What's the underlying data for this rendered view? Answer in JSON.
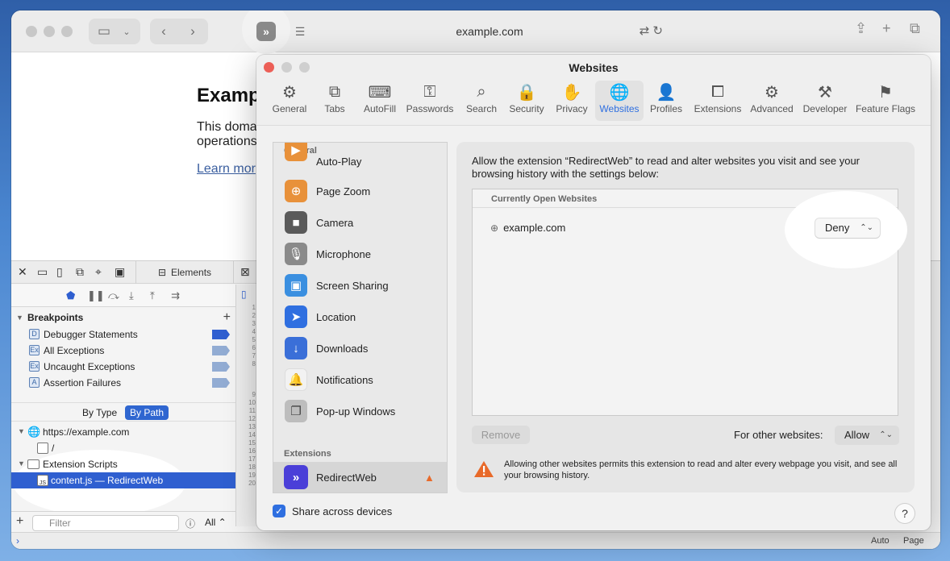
{
  "browser": {
    "url": "example.com",
    "extension_icon": "redirectweb-icon"
  },
  "page": {
    "heading": "Examp",
    "paragraph_line1": "This doma",
    "paragraph_line2": "operations",
    "link": "Learn mor"
  },
  "inspector": {
    "elements_tab": "Elements",
    "breakpoints_title": "Breakpoints",
    "breakpoints": [
      {
        "badge": "D",
        "label": "Debugger Statements",
        "active": true
      },
      {
        "badge": "Ex",
        "label": "All Exceptions",
        "active": false
      },
      {
        "badge": "Ex",
        "label": "Uncaught Exceptions",
        "active": false
      },
      {
        "badge": "A",
        "label": "Assertion Failures",
        "active": false
      }
    ],
    "by_type": "By Type",
    "by_path": "By Path",
    "tree": {
      "origin": "https://example.com",
      "root_path": "/",
      "extension_scripts": "Extension Scripts",
      "selected_file": "content.js — RedirectWeb",
      "file_badge": "JS"
    },
    "filter_placeholder": "Filter",
    "filter_scope": "All",
    "gutter_lines": [
      "1",
      "2",
      "3",
      "4",
      "5",
      "6",
      "7",
      "8",
      "",
      "9",
      "10",
      "11",
      "12",
      "13",
      "14",
      "15",
      "16",
      "17",
      "18",
      "19",
      "20"
    ],
    "status_right_1": "Auto",
    "status_right_2": "Page"
  },
  "settings": {
    "title": "Websites",
    "tabs": [
      {
        "label": "General",
        "icon": "gear-icon",
        "glyph": "⚙"
      },
      {
        "label": "Tabs",
        "icon": "tabs-icon",
        "glyph": "⧉"
      },
      {
        "label": "AutoFill",
        "icon": "autofill-icon",
        "glyph": "⌨"
      },
      {
        "label": "Passwords",
        "icon": "key-icon",
        "glyph": "⚿"
      },
      {
        "label": "Search",
        "icon": "search-icon",
        "glyph": "⌕"
      },
      {
        "label": "Security",
        "icon": "lock-icon",
        "glyph": "🔒"
      },
      {
        "label": "Privacy",
        "icon": "hand-icon",
        "glyph": "✋"
      },
      {
        "label": "Websites",
        "icon": "globe-icon",
        "glyph": "🌐"
      },
      {
        "label": "Profiles",
        "icon": "person-icon",
        "glyph": "👤"
      },
      {
        "label": "Extensions",
        "icon": "puzzle-icon",
        "glyph": "⧠"
      },
      {
        "label": "Advanced",
        "icon": "gears-icon",
        "glyph": "⚙"
      },
      {
        "label": "Developer",
        "icon": "tools-icon",
        "glyph": "⚒"
      },
      {
        "label": "Feature Flags",
        "icon": "flags-icon",
        "glyph": "⚑"
      }
    ],
    "list_general_header": "General",
    "list_items": [
      {
        "label": "Auto-Play",
        "icon": "autoplay-icon",
        "color": "#e8913a",
        "glyph": "▶"
      },
      {
        "label": "Page Zoom",
        "icon": "zoom-icon",
        "color": "#e8913a",
        "glyph": "⊕"
      },
      {
        "label": "Camera",
        "icon": "camera-icon",
        "color": "#5a5a5a",
        "glyph": "■"
      },
      {
        "label": "Microphone",
        "icon": "microphone-icon",
        "color": "#8a8a8a",
        "glyph": "🎙"
      },
      {
        "label": "Screen Sharing",
        "icon": "screen-sharing-icon",
        "color": "#3a8fe0",
        "glyph": "▣"
      },
      {
        "label": "Location",
        "icon": "location-icon",
        "color": "#2f6fe0",
        "glyph": "➤"
      },
      {
        "label": "Downloads",
        "icon": "download-icon",
        "color": "#3a6fd8",
        "glyph": "↓"
      },
      {
        "label": "Notifications",
        "icon": "bell-icon",
        "color": "#f2f2f2",
        "glyph": "🔔"
      },
      {
        "label": "Pop-up Windows",
        "icon": "popup-icon",
        "color": "#bdbdbd",
        "glyph": "❐"
      }
    ],
    "list_extensions_header": "Extensions",
    "extension_item": {
      "label": "RedirectWeb",
      "icon": "redirectweb-icon",
      "color": "#4a3fd8"
    },
    "description": "Allow the extension “RedirectWeb” to read and alter websites you visit and see your browsing history with the settings below:",
    "sites_header": "Currently Open Websites",
    "site": "example.com",
    "site_permission": "Deny",
    "remove_label": "Remove",
    "other_websites_label": "For other websites:",
    "other_websites_value": "Allow",
    "warning": "Allowing other websites permits this extension to read and alter every webpage you visit, and see all your browsing history.",
    "share_label": "Share across devices",
    "share_checked": true,
    "help_label": "?"
  }
}
